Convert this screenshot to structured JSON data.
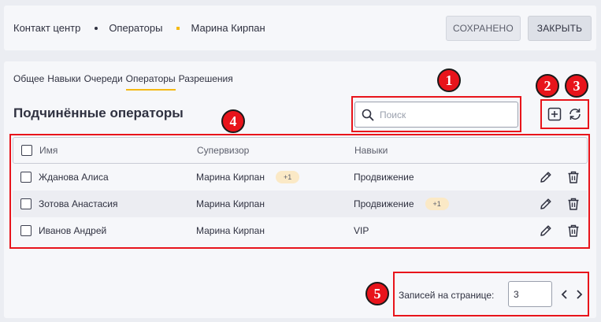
{
  "breadcrumb": [
    "Контакт центр",
    "Операторы",
    "Марина Кирпан"
  ],
  "header": {
    "saved_label": "СОХРАНЕНО",
    "close_label": "ЗАКРЫТЬ"
  },
  "tabs": [
    "Общее",
    "Навыки",
    "Очереди",
    "Операторы",
    "Разрешения"
  ],
  "active_tab": "Операторы",
  "section_title": "Подчинённые операторы",
  "search": {
    "placeholder": "Поиск"
  },
  "table": {
    "columns": [
      "Имя",
      "Супервизор",
      "Навыки"
    ],
    "rows": [
      {
        "name": "Жданова Алиса",
        "supervisor": "Марина Кирпан",
        "supervisor_extra": "+1",
        "skills": "Продвижение",
        "skills_extra": ""
      },
      {
        "name": "Зотова Анастасия",
        "supervisor": "Марина Кирпан",
        "supervisor_extra": "",
        "skills": "Продвижение",
        "skills_extra": "+1"
      },
      {
        "name": "Иванов Андрей",
        "supervisor": "Марина Кирпан",
        "supervisor_extra": "",
        "skills": "VIP",
        "skills_extra": ""
      }
    ]
  },
  "pagination": {
    "label": "Записей на странице:",
    "value": "3"
  },
  "annotations": [
    "1",
    "2",
    "3",
    "4",
    "5"
  ],
  "colors": {
    "accent": "#f5b914",
    "annotation": "#e8141b"
  }
}
